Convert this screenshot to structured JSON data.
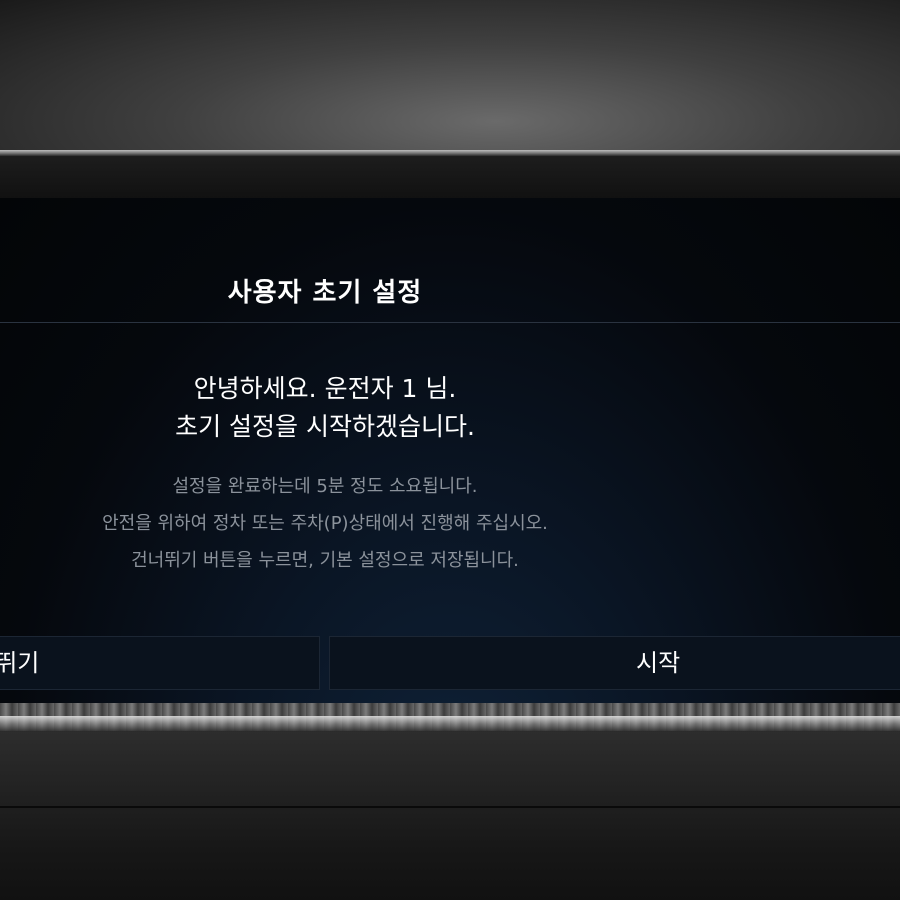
{
  "dialog": {
    "title": "사용자 초기 설정",
    "greeting_line1": "안녕하세요. 운전자 1 님.",
    "greeting_line2": "초기 설정을 시작하겠습니다.",
    "info_line1": "설정을 완료하는데 5분 정도 소요됩니다.",
    "info_line2": "안전을 위하여 정차 또는 주차(P)상태에서 진행해 주십시오.",
    "info_line3": "건너뛰기 버튼을 누르면, 기본 설정으로 저장됩니다."
  },
  "buttons": {
    "skip_label": "건너뛰기",
    "start_label": "시작"
  }
}
